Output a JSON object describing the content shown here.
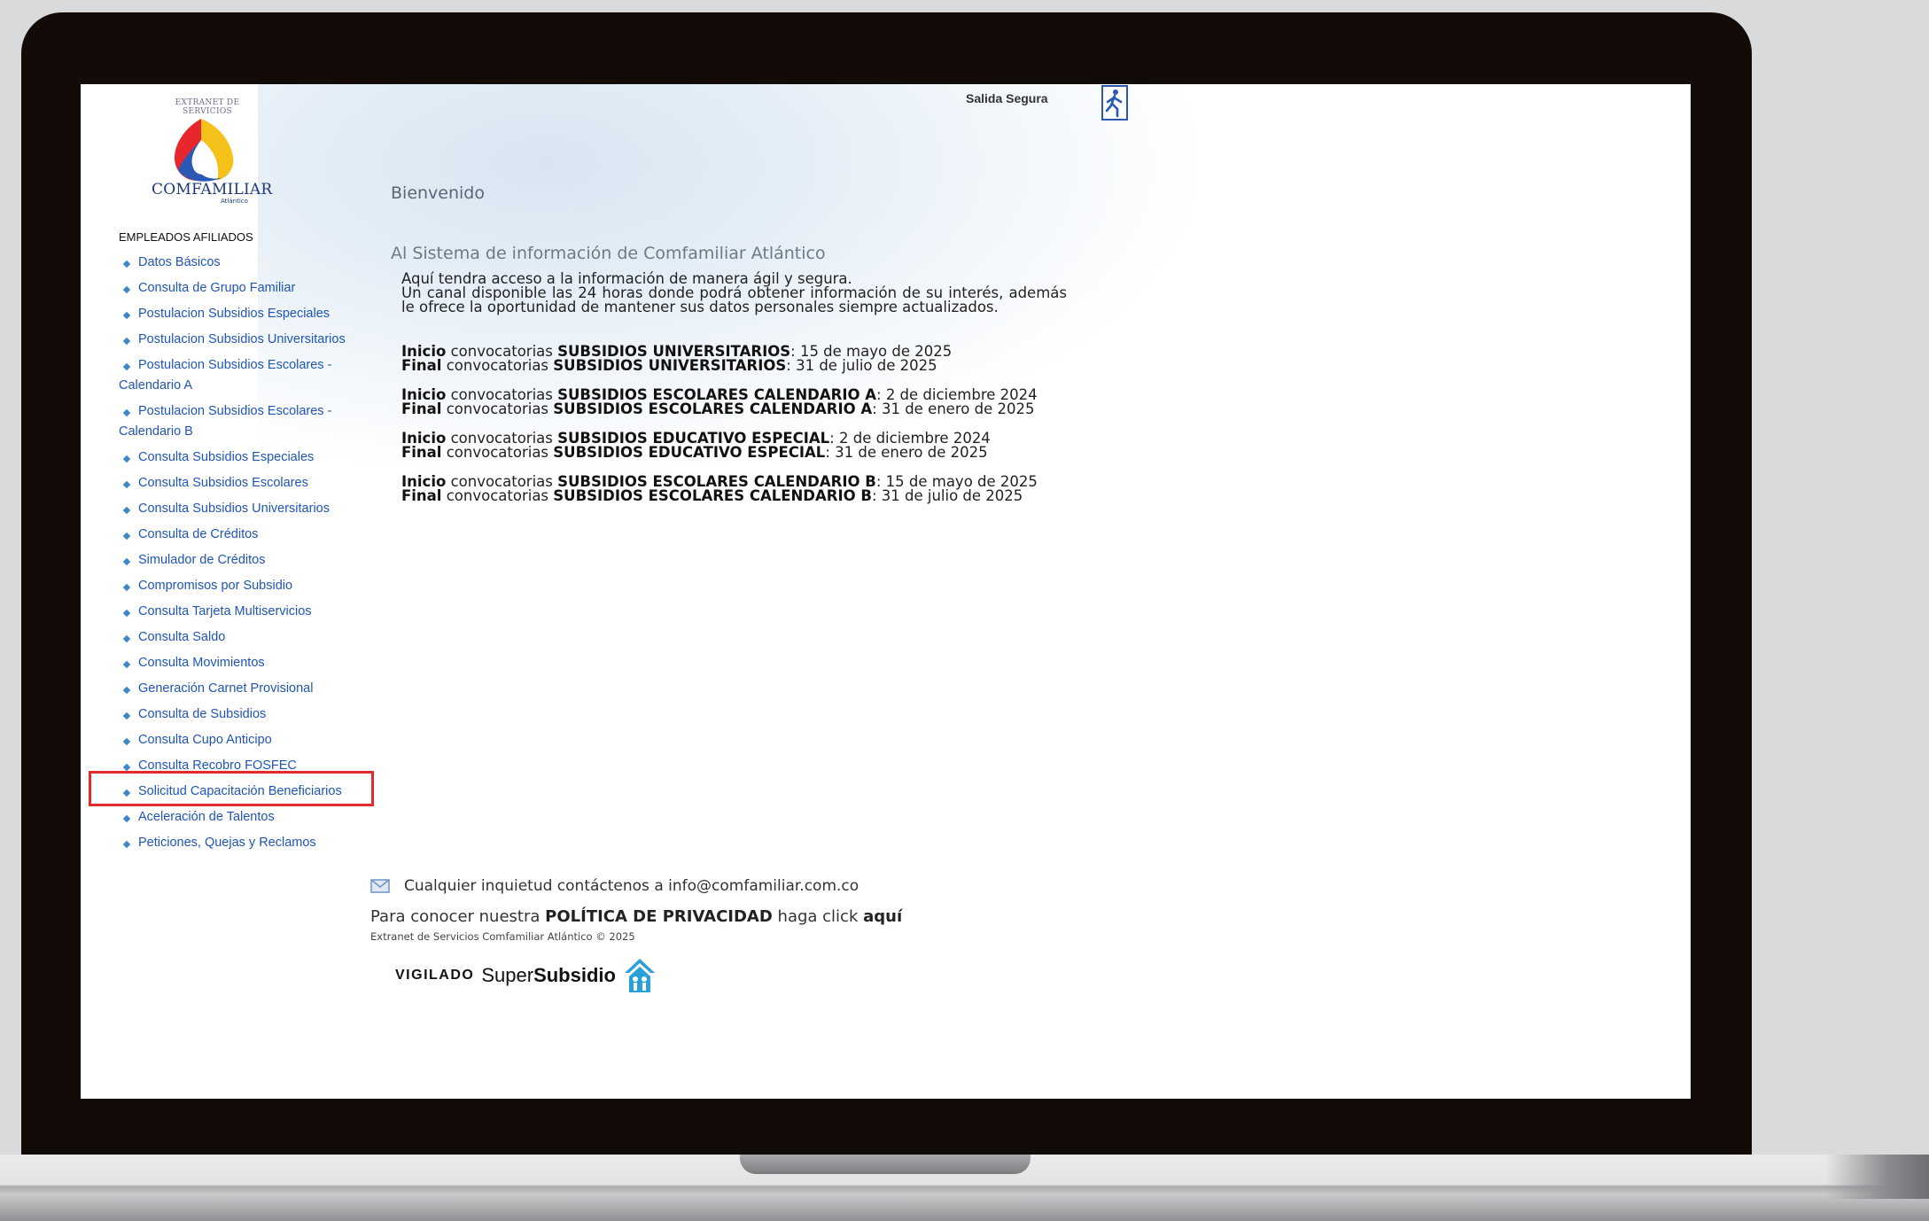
{
  "header": {
    "brand_extranet": "EXTRANET DE SERVICIOS",
    "brand_name": "COMFAMILIAR",
    "brand_sub": "Atlántico",
    "logout_label": "Salida Segura"
  },
  "sidebar": {
    "heading": "EMPLEADOS AFILIADOS",
    "items": [
      "Datos Básicos",
      "Consulta de Grupo Familiar",
      "Postulacion Subsidios Especiales",
      "Postulacion Subsidios Universitarios",
      "Postulacion Subsidios Escolares - Calendario A",
      "Postulacion Subsidios Escolares - Calendario B",
      "Consulta Subsidios Especiales",
      "Consulta Subsidios Escolares",
      "Consulta Subsidios Universitarios",
      "Consulta de Créditos",
      "Simulador de Créditos",
      "Compromisos por Subsidio",
      "Consulta Tarjeta Multiservicios",
      "Consulta Saldo",
      "Consulta Movimientos",
      "Generación Carnet Provisional",
      "Consulta de Subsidios",
      "Consulta Cupo Anticipo",
      "Consulta Recobro FOSFEC",
      "Solicitud Capacitación Beneficiarios",
      "Aceleración de Talentos",
      "Peticiones, Quejas y Reclamos"
    ]
  },
  "main": {
    "welcome": "Bienvenido",
    "subtitle": "Al Sistema de información de Comfamiliar Atlántico",
    "intro_line1": "Aquí tendra acceso a la información de manera ágil y segura.",
    "intro_rest": "Un canal disponible las 24 horas donde podrá obtener información de su interés, además le ofrece la oportunidad de mantener sus datos personales siempre actualizados.",
    "inicio_label": "Inicio",
    "final_label": "Final",
    "convocatorias_word": "convocatorias",
    "calls": [
      {
        "name": "SUBSIDIOS UNIVERSITARIOS",
        "start": ": 15 de mayo de 2025",
        "end": ": 31 de julio de 2025"
      },
      {
        "name": "SUBSIDIOS ESCOLARES CALENDARIO A",
        "start": ": 2 de diciembre 2024",
        "end": ": 31 de enero de 2025"
      },
      {
        "name": "SUBSIDIOS EDUCATIVO ESPECIAL",
        "start": ": 2 de diciembre 2024",
        "end": ": 31 de enero de 2025"
      },
      {
        "name": "SUBSIDIOS ESCOLARES CALENDARIO B",
        "start": ": 15 de mayo de 2025",
        "end": ": 31 de julio de 2025"
      }
    ]
  },
  "footer": {
    "contact_text": "Cualquier inquietud contáctenos a info@comfamiliar.com.co",
    "privacy_prefix": "Para conocer nuestra ",
    "privacy_bold": "POLÍTICA DE PRIVACIDAD",
    "privacy_middle": " haga click ",
    "privacy_link": "aquí",
    "copyright": "Extranet de Servicios Comfamiliar Atlántico © 2025",
    "vigilado": "VIGILADO",
    "super_light": "Super",
    "super_bold": "Subsidio"
  },
  "colors": {
    "link": "#1f55b8",
    "highlight": "#e22b2b",
    "bezel": "#120b08"
  }
}
